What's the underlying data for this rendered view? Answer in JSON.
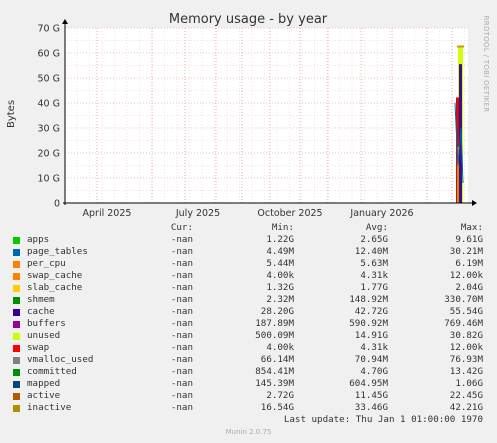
{
  "chart_data": {
    "type": "area",
    "title": "Memory usage - by year",
    "ylabel": "Bytes",
    "side_label": "RRDTOOL / TOBI OETIKER",
    "y_ticks": [
      "0",
      "10 G",
      "20 G",
      "30 G",
      "40 G",
      "50 G",
      "60 G",
      "70 G"
    ],
    "ylim_gb": [
      0,
      70
    ],
    "x_ticks": [
      "April 2025",
      "July 2025",
      "October 2025",
      "January 2026"
    ],
    "grid": true,
    "bg_color": "#ffffff",
    "grid_color": "#e8a0a0",
    "spike_series_gb": [
      {
        "name": "inactive",
        "color": "#cc0000",
        "values": [
          42.21
        ]
      },
      {
        "name": "active",
        "color": "#cc9900",
        "values": [
          22.45
        ]
      },
      {
        "name": "cache",
        "color": "#330099",
        "values": [
          55.54
        ]
      },
      {
        "name": "unused",
        "color": "#ccff00",
        "values": [
          62.5
        ]
      }
    ]
  },
  "legend": {
    "headers": {
      "cur": "Cur:",
      "min": "Min:",
      "avg": "Avg:",
      "max": "Max:"
    },
    "rows": [
      {
        "name": "apps",
        "color": "#00cc00",
        "cur": "-nan",
        "min": "1.22G",
        "avg": "2.65G",
        "max": "9.61G"
      },
      {
        "name": "page_tables",
        "color": "#0066b3",
        "cur": "-nan",
        "min": "4.49M",
        "avg": "12.40M",
        "max": "30.21M"
      },
      {
        "name": "per_cpu",
        "color": "#ff8000",
        "cur": "-nan",
        "min": "5.44M",
        "avg": "5.63M",
        "max": "6.19M"
      },
      {
        "name": "swap_cache",
        "color": "#ff8000",
        "cur": "-nan",
        "min": "4.00k",
        "avg": "4.31k",
        "max": "12.00k"
      },
      {
        "name": "slab_cache",
        "color": "#ffcc00",
        "cur": "-nan",
        "min": "1.32G",
        "avg": "1.77G",
        "max": "2.04G"
      },
      {
        "name": "shmem",
        "color": "#008f00",
        "cur": "-nan",
        "min": "2.32M",
        "avg": "148.92M",
        "max": "330.70M"
      },
      {
        "name": "cache",
        "color": "#330099",
        "cur": "-nan",
        "min": "28.20G",
        "avg": "42.72G",
        "max": "55.54G"
      },
      {
        "name": "buffers",
        "color": "#990099",
        "cur": "-nan",
        "min": "187.89M",
        "avg": "590.92M",
        "max": "769.46M"
      },
      {
        "name": "unused",
        "color": "#ccff00",
        "cur": "-nan",
        "min": "500.09M",
        "avg": "14.91G",
        "max": "30.82G"
      },
      {
        "name": "swap",
        "color": "#ff0000",
        "cur": "-nan",
        "min": "4.00k",
        "avg": "4.31k",
        "max": "12.00k"
      },
      {
        "name": "vmalloc_used",
        "color": "#808080",
        "cur": "-nan",
        "min": "66.14M",
        "avg": "70.94M",
        "max": "76.93M"
      },
      {
        "name": "committed",
        "color": "#008f00",
        "cur": "-nan",
        "min": "854.41M",
        "avg": "4.70G",
        "max": "13.42G"
      },
      {
        "name": "mapped",
        "color": "#00487d",
        "cur": "-nan",
        "min": "145.39M",
        "avg": "604.95M",
        "max": "1.06G"
      },
      {
        "name": "active",
        "color": "#b35a00",
        "cur": "-nan",
        "min": "2.72G",
        "avg": "11.45G",
        "max": "22.45G"
      },
      {
        "name": "inactive",
        "color": "#b38f00",
        "cur": "-nan",
        "min": "16.54G",
        "avg": "33.46G",
        "max": "42.21G"
      }
    ]
  },
  "last_update": "Last update: Thu Jan  1 01:00:00 1970",
  "footer": "Munin 2.0.75"
}
